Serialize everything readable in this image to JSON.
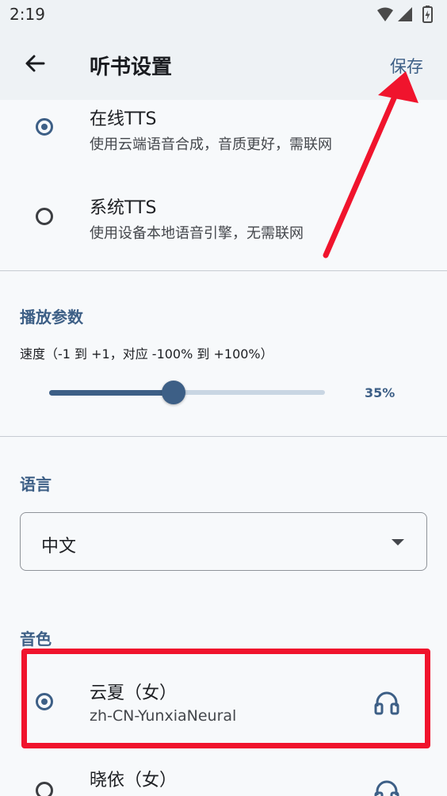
{
  "status_bar": {
    "time": "2:19",
    "icons": [
      "wifi-icon",
      "signal-icon",
      "battery-icon"
    ]
  },
  "app_bar": {
    "title": "听书设置",
    "save_label": "保存",
    "back_icon": "arrow-back-icon"
  },
  "engine": {
    "options": [
      {
        "title": "在线TTS",
        "subtitle": "使用云端语音合成，音质更好，需联网",
        "selected": true
      },
      {
        "title": "系统TTS",
        "subtitle": "使用设备本地语音引擎，无需联网",
        "selected": false
      }
    ]
  },
  "playback": {
    "section_title": "播放参数",
    "speed_label": "速度（-1 到 +1，对应 -100% 到 +100%）",
    "speed_value_text": "35%",
    "speed_fraction": 0.45
  },
  "language": {
    "section_title": "语言",
    "selected": "中文"
  },
  "voice": {
    "section_title": "音色",
    "items": [
      {
        "name": "云夏（女）",
        "id": "zh-CN-YunxiaNeural",
        "selected": true
      },
      {
        "name": "晓依（女）",
        "id": "",
        "selected": false
      }
    ]
  },
  "colors": {
    "accent": "#3d5f86",
    "annotation": "#f0142d",
    "background": "#f7f9fb",
    "app_bar": "#eef2f5"
  }
}
